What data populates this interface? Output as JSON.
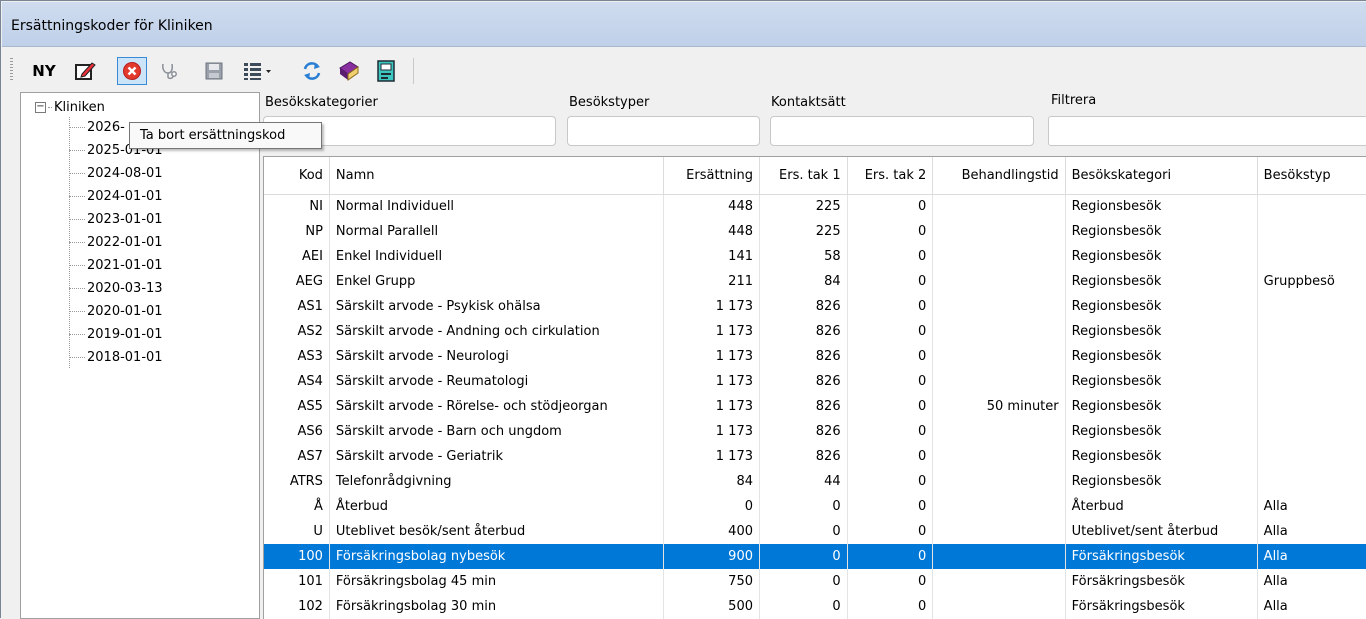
{
  "window": {
    "title": "Ersättningskoder för Kliniken"
  },
  "toolbar": {
    "new_label": "NY",
    "icons": [
      "edit-icon",
      "delete-icon",
      "stethoscope-icon",
      "save-icon",
      "list-view-icon",
      "refresh-icon",
      "book-icon",
      "report-icon"
    ]
  },
  "tooltip": {
    "text": "Ta bort ersättningskod"
  },
  "tree": {
    "root_label": "Kliniken",
    "items": [
      "2026-",
      "2025-01-01",
      "2024-08-01",
      "2024-01-01",
      "2023-01-01",
      "2022-01-01",
      "2021-01-01",
      "2020-03-13",
      "2020-01-01",
      "2019-01-01",
      "2018-01-01"
    ]
  },
  "filters": {
    "besokskategorier_label": "Besökskategorier",
    "besokstyper_label": "Besökstyper",
    "kontaktsatt_label": "Kontaktsätt",
    "filtrera_label": "Filtrera"
  },
  "table": {
    "columns": [
      "Kod",
      "Namn",
      "Ersättning",
      "Ers. tak 1",
      "Ers. tak 2",
      "Behandlingstid",
      "Besökskategori",
      "Besökstyp"
    ],
    "rows": [
      [
        "NI",
        "Normal Individuell",
        "448",
        "225",
        "0",
        "",
        "Regionsbesök",
        ""
      ],
      [
        "NP",
        "Normal Parallell",
        "448",
        "225",
        "0",
        "",
        "Regionsbesök",
        ""
      ],
      [
        "AEI",
        "Enkel Individuell",
        "141",
        "58",
        "0",
        "",
        "Regionsbesök",
        ""
      ],
      [
        "AEG",
        "Enkel Grupp",
        "211",
        "84",
        "0",
        "",
        "Regionsbesök",
        "Gruppbesö"
      ],
      [
        "AS1",
        "Särskilt arvode - Psykisk ohälsa",
        "1 173",
        "826",
        "0",
        "",
        "Regionsbesök",
        ""
      ],
      [
        "AS2",
        "Särskilt arvode - Andning och cirkulation",
        "1 173",
        "826",
        "0",
        "",
        "Regionsbesök",
        ""
      ],
      [
        "AS3",
        "Särskilt arvode - Neurologi",
        "1 173",
        "826",
        "0",
        "",
        "Regionsbesök",
        ""
      ],
      [
        "AS4",
        "Särskilt arvode - Reumatologi",
        "1 173",
        "826",
        "0",
        "",
        "Regionsbesök",
        ""
      ],
      [
        "AS5",
        "Särskilt arvode - Rörelse- och stödjeorgan",
        "1 173",
        "826",
        "0",
        "50 minuter",
        "Regionsbesök",
        ""
      ],
      [
        "AS6",
        "Särskilt arvode - Barn och ungdom",
        "1 173",
        "826",
        "0",
        "",
        "Regionsbesök",
        ""
      ],
      [
        "AS7",
        "Särskilt arvode - Geriatrik",
        "1 173",
        "826",
        "0",
        "",
        "Regionsbesök",
        ""
      ],
      [
        "ATRS",
        "Telefonrådgivning",
        "84",
        "44",
        "0",
        "",
        "Regionsbesök",
        ""
      ],
      [
        "Å",
        "Återbud",
        "0",
        "0",
        "0",
        "",
        "Återbud",
        "Alla"
      ],
      [
        "U",
        "Uteblivet besök/sent återbud",
        "400",
        "0",
        "0",
        "",
        "Uteblivet/sent återbud",
        "Alla"
      ],
      [
        "100",
        "Försäkringsbolag nybesök",
        "900",
        "0",
        "0",
        "",
        "Försäkringsbesök",
        "Alla"
      ],
      [
        "101",
        "Försäkringsbolag 45 min",
        "750",
        "0",
        "0",
        "",
        "Försäkringsbesök",
        "Alla"
      ],
      [
        "102",
        "Försäkringsbolag 30 min",
        "500",
        "0",
        "0",
        "",
        "Försäkringsbesök",
        "Alla"
      ]
    ],
    "selected_row_index": 14
  },
  "colors": {
    "selection": "#0078d7",
    "titlebar": "#c4d4ec"
  }
}
